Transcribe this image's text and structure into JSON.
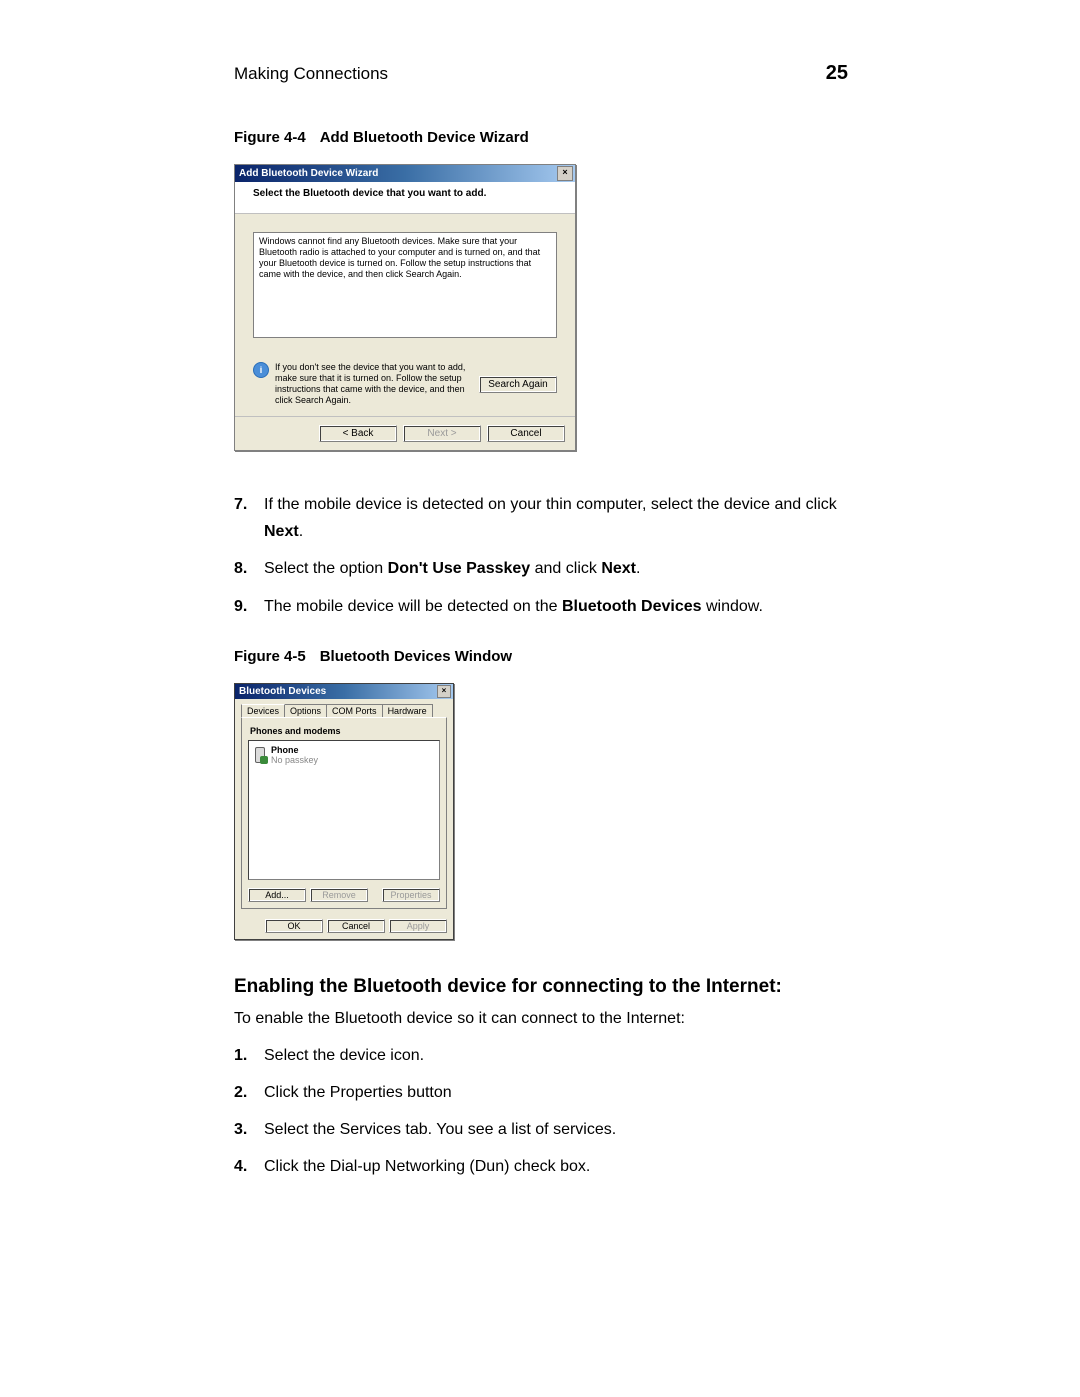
{
  "header": {
    "section_title": "Making Connections",
    "page_number": "25"
  },
  "figure_4_4": {
    "caption_prefix": "Figure 4-4",
    "caption_title": "Add Bluetooth Device Wizard",
    "window": {
      "title": "Add Bluetooth Device Wizard",
      "close_glyph": "×",
      "header_instruction": "Select the Bluetooth device that you want to add.",
      "error_message": "Windows cannot find any Bluetooth devices. Make sure that your Bluetooth radio is attached to your computer and is turned on, and that your Bluetooth device is turned on. Follow the setup instructions that came with the device, and then click Search Again.",
      "info_glyph": "i",
      "info_text": "If you don't see the device that you want to add, make sure that it is turned on. Follow the setup instructions that came with the device, and then click Search Again.",
      "buttons": {
        "search_again": "Search Again",
        "back": "< Back",
        "next": "Next >",
        "cancel": "Cancel"
      }
    }
  },
  "steps_a": {
    "s7": {
      "num": "7.",
      "pre": "If the mobile device is detected on your thin computer, select the device and click ",
      "bold": "Next",
      "post": "."
    },
    "s8": {
      "num": "8.",
      "pre": "Select the option ",
      "bold1": "Don't Use Passkey",
      "mid": " and click ",
      "bold2": "Next",
      "post": "."
    },
    "s9": {
      "num": "9.",
      "pre": "The mobile device will be detected on the ",
      "bold": "Bluetooth Devices",
      "post": " window."
    }
  },
  "figure_4_5": {
    "caption_prefix": "Figure 4-5",
    "caption_title": "Bluetooth Devices Window",
    "window": {
      "title": "Bluetooth Devices",
      "close_glyph": "×",
      "tabs": {
        "devices": "Devices",
        "options": "Options",
        "com_ports": "COM Ports",
        "hardware": "Hardware"
      },
      "group_label": "Phones and modems",
      "item": {
        "name": "Phone",
        "status": "No passkey"
      },
      "buttons": {
        "add": "Add...",
        "remove": "Remove",
        "properties": "Properties",
        "ok": "OK",
        "cancel": "Cancel",
        "apply": "Apply"
      }
    }
  },
  "section2": {
    "heading": "Enabling the Bluetooth device for connecting to the Internet:",
    "intro": "To enable the Bluetooth device so it can connect to the Internet:",
    "steps": {
      "s1": {
        "num": "1.",
        "text": "Select the device icon."
      },
      "s2": {
        "num": "2.",
        "text": "Click the Properties button"
      },
      "s3": {
        "num": "3.",
        "text": "Select the Services tab. You see a list of services."
      },
      "s4": {
        "num": "4.",
        "text": "Click the Dial-up Networking (Dun) check box."
      }
    }
  }
}
